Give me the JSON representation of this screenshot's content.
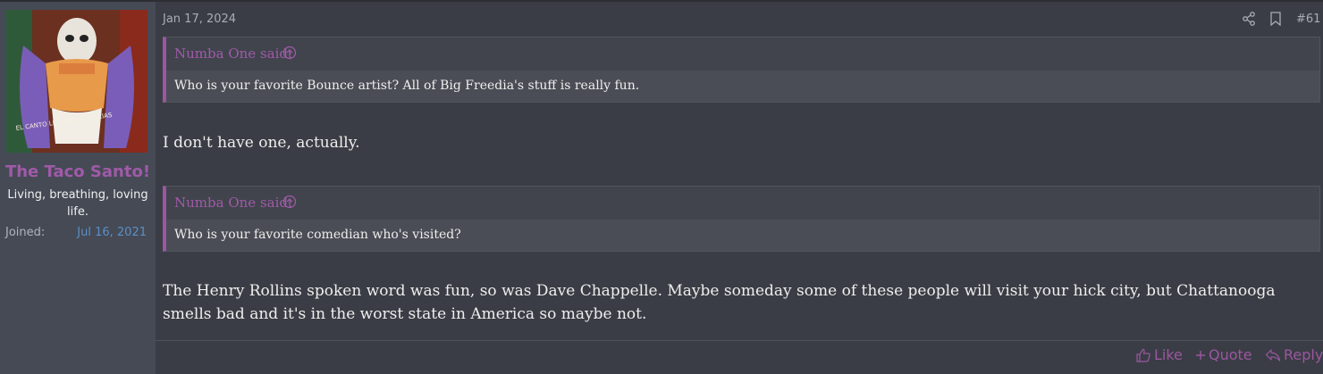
{
  "user": {
    "name": "The Taco Santo!",
    "title": "Living, breathing, loving life.",
    "joined_label": "Joined:",
    "joined_value": "Jul 16, 2021",
    "avatar_caption": "EL CANTO LE DA MAS GRACIAS"
  },
  "post": {
    "date": "Jan 17, 2024",
    "number": "#61",
    "quotes": [
      {
        "author_line": "Numba One said:",
        "text": "Who is your favorite Bounce artist? All of Big Freedia's stuff is really fun."
      },
      {
        "author_line": "Numba One said:",
        "text": "Who is your favorite comedian who's visited?"
      }
    ],
    "replies": [
      "I don't have one, actually.",
      "The Henry Rollins spoken word was fun, so was Dave Chappelle. Maybe someday some of these people will visit your hick city, but Chattanooga smells bad and it's in the worst state in America so maybe not."
    ]
  },
  "actions": {
    "like": "Like",
    "quote": "Quote",
    "reply": "Reply"
  },
  "colors": {
    "accent": "#9b57a0",
    "username": "#a05aa8",
    "joined_date": "#5b8fc7",
    "background": "#3a3d45",
    "sidebar": "#454a55"
  },
  "icons": {
    "share": "share-icon",
    "bookmark": "bookmark-icon",
    "quote_jump": "arrow-up-circle-icon",
    "like": "thumbs-up-icon",
    "quote": "plus-icon",
    "reply": "reply-icon"
  }
}
